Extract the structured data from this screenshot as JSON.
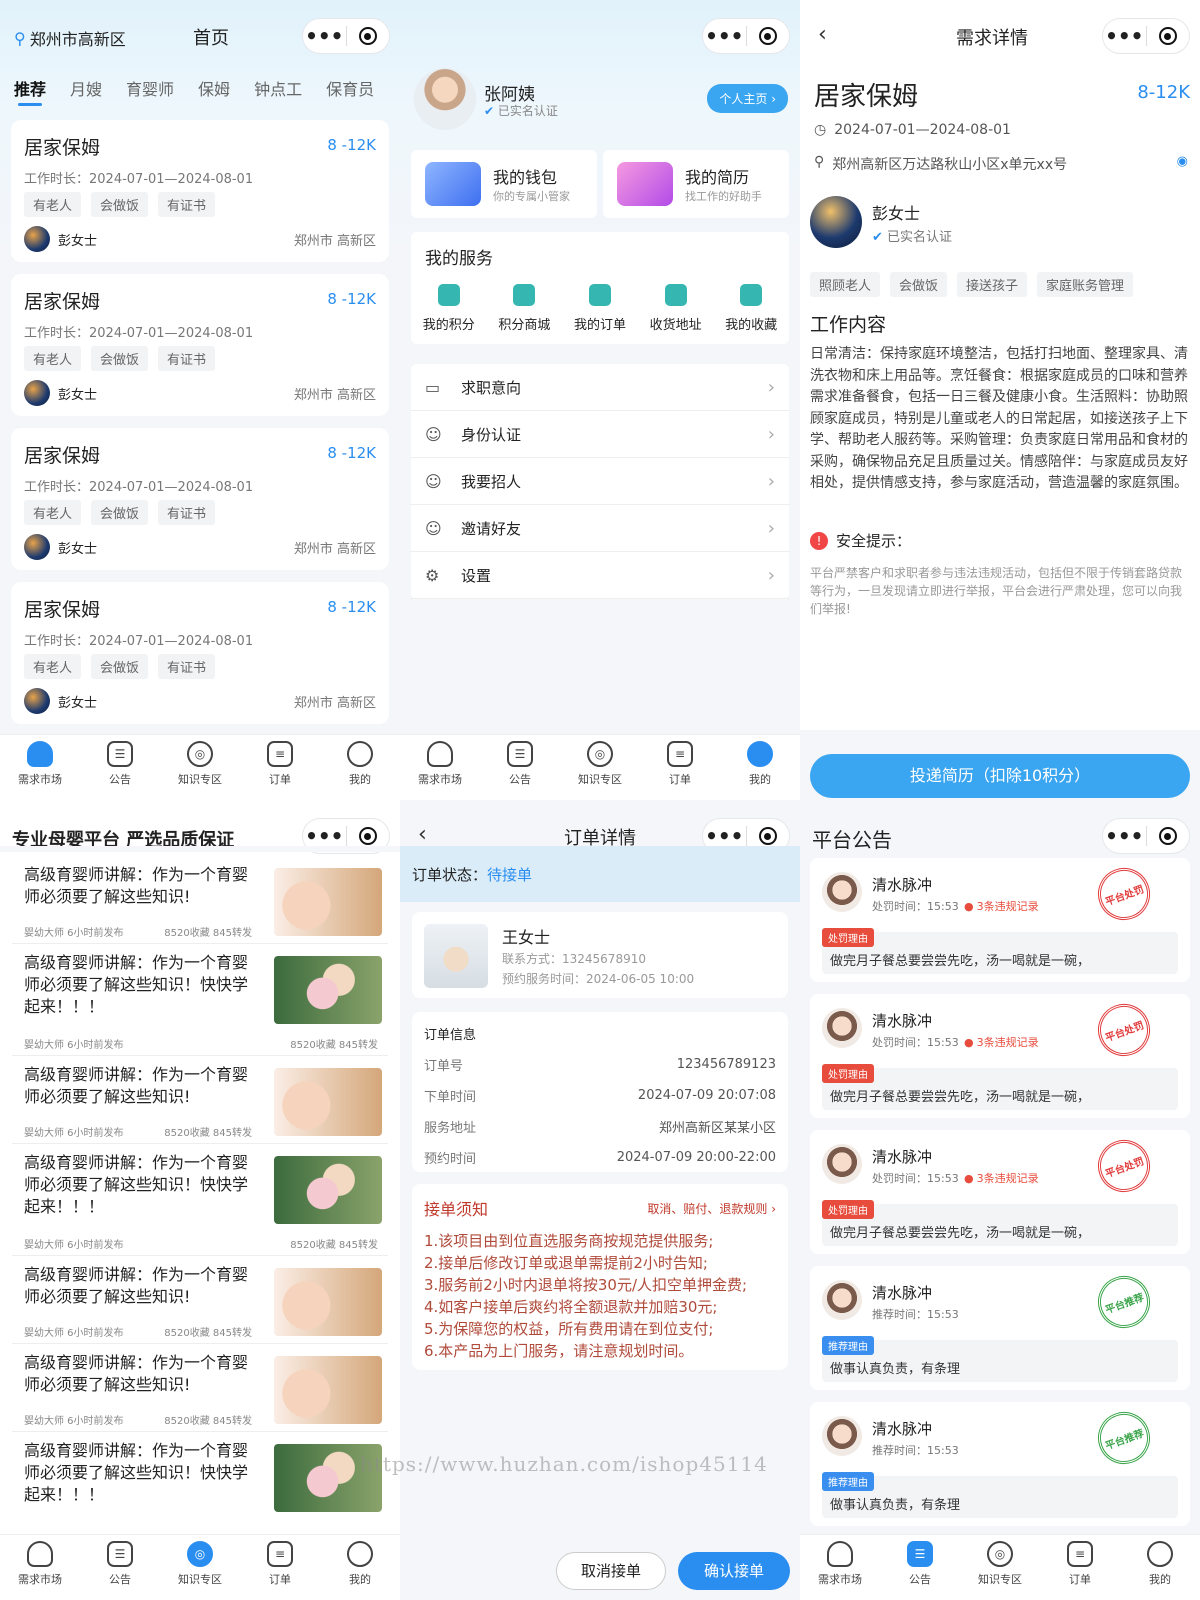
{
  "tabbar": {
    "items": [
      "需求市场",
      "公告",
      "知识专区",
      "订单",
      "我的"
    ]
  },
  "capsule": {
    "dots": "•••"
  },
  "home": {
    "location": "郑州市高新区",
    "title": "首页",
    "tabs": [
      "推荐",
      "月嫂",
      "育婴师",
      "保姆",
      "钟点工",
      "保育员"
    ],
    "jobs": [
      {
        "title": "居家保姆",
        "salary": "8 -12K",
        "duration": "工作时长：2024-07-01—2024-08-01",
        "tags": [
          "有老人",
          "会做饭",
          "有证书"
        ],
        "user": "彭女士",
        "city": "郑州市 高新区"
      },
      {
        "title": "居家保姆",
        "salary": "8 -12K",
        "duration": "工作时长：2024-07-01—2024-08-01",
        "tags": [
          "有老人",
          "会做饭",
          "有证书"
        ],
        "user": "彭女士",
        "city": "郑州市 高新区"
      },
      {
        "title": "居家保姆",
        "salary": "8 -12K",
        "duration": "工作时长：2024-07-01—2024-08-01",
        "tags": [
          "有老人",
          "会做饭",
          "有证书"
        ],
        "user": "彭女士",
        "city": "郑州市 高新区"
      },
      {
        "title": "居家保姆",
        "salary": "8 -12K",
        "duration": "工作时长：2024-07-01—2024-08-01",
        "tags": [
          "有老人",
          "会做饭",
          "有证书"
        ],
        "user": "彭女士",
        "city": "郑州市 高新区"
      }
    ]
  },
  "mine": {
    "name": "张阿姨",
    "verified": "已实名认证",
    "home_btn": "个人主页 ›",
    "wallet": {
      "title": "我的钱包",
      "sub": "你的专属小管家"
    },
    "resume": {
      "title": "我的简历",
      "sub": "找工作的好助手"
    },
    "services_title": "我的服务",
    "services": [
      "我的积分",
      "积分商城",
      "我的订单",
      "收货地址",
      "我的收藏"
    ],
    "menu": [
      "求职意向",
      "身份认证",
      "我要招人",
      "邀请好友",
      "设置"
    ]
  },
  "detail": {
    "nav_title": "需求详情",
    "title": "居家保姆",
    "salary": "8-12K",
    "date": "2024-07-01—2024-08-01",
    "address": "郑州高新区万达路秋山小区x单元xx号",
    "user": "彭女士",
    "verified": "已实名认证",
    "tags": [
      "照顾老人",
      "会做饭",
      "接送孩子",
      "家庭账务管理"
    ],
    "content_title": "工作内容",
    "content": "日常清洁：保持家庭环境整洁，包括打扫地面、整理家具、清洗衣物和床上用品等。烹饪餐食：根据家庭成员的口味和营养需求准备餐食，包括一日三餐及健康小食。生活照料：协助照顾家庭成员，特别是儿童或老人的日常起居，如接送孩子上下学、帮助老人服药等。采购管理：负责家庭日常用品和食材的采购，确保物品充足且质量过关。情感陪伴：与家庭成员友好相处，提供情感支持，参与家庭活动，营造温馨的家庭氛围。",
    "safety_title": "安全提示：",
    "safety": "平台严禁客户和求职者参与违法违规活动，包括但不限于传销套路贷款等行为，一旦发现请立即进行举报，平台会进行严肃处理，您可以向我们举报!",
    "submit": "投递简历（扣除10积分）"
  },
  "knowledge": {
    "title": "专业母婴平台  严选品质保证",
    "articles": [
      {
        "title": "高级育婴师讲解：作为一个育婴师必须要了解这些知识!",
        "author": "婴幼大师 6小时前发布",
        "stats": "8520收藏  845转发",
        "img": "a"
      },
      {
        "title": "高级育婴师讲解：作为一个育婴师必须要了解这些知识！快快学起来！！！",
        "author": "婴幼大师 6小时前发布",
        "stats": "8520收藏  845转发",
        "img": "b"
      },
      {
        "title": "高级育婴师讲解：作为一个育婴师必须要了解这些知识!",
        "author": "婴幼大师 6小时前发布",
        "stats": "8520收藏  845转发",
        "img": "a"
      },
      {
        "title": "高级育婴师讲解：作为一个育婴师必须要了解这些知识！快快学起来！！！",
        "author": "婴幼大师 6小时前发布",
        "stats": "8520收藏  845转发",
        "img": "b"
      },
      {
        "title": "高级育婴师讲解：作为一个育婴师必须要了解这些知识!",
        "author": "婴幼大师 6小时前发布",
        "stats": "8520收藏  845转发",
        "img": "a"
      },
      {
        "title": "高级育婴师讲解：作为一个育婴师必须要了解这些知识!",
        "author": "婴幼大师 6小时前发布",
        "stats": "8520收藏  845转发",
        "img": "a"
      },
      {
        "title": "高级育婴师讲解：作为一个育婴师必须要了解这些知识！快快学起来！！！",
        "author": "",
        "stats": "",
        "img": "b"
      }
    ]
  },
  "order": {
    "nav_title": "订单详情",
    "status_label": "订单状态：",
    "status": "待接单",
    "customer": "王女士",
    "phone": "联系方式：13245678910",
    "appoint": "预约服务时间：2024-06-05 10:00",
    "info_title": "订单信息",
    "rows": [
      {
        "k": "订单号",
        "v": "123456789123"
      },
      {
        "k": "下单时间",
        "v": "2024-07-09 20:07:08"
      },
      {
        "k": "服务地址",
        "v": "郑州高新区某某小区"
      },
      {
        "k": "预约时间",
        "v": "2024-07-09 20:00-22:00"
      }
    ],
    "notice_title": "接单须知",
    "notice_link": "取消、赔付、退款规则  ›",
    "notice": [
      "1.该项目由到位直选服务商按规范提供服务;",
      "2.接单后修改订单或退单需提前2小时告知;",
      "3.服务前2小时内退单将按30元/人扣空单押金费;",
      "4.如客户接单后爽约将全额退款并加赔30元;",
      "5.为保障您的权益，所有费用请在到位支付;",
      "6.本产品为上门服务，请注意规划时间。"
    ],
    "cancel": "取消接单",
    "confirm": "确认接单"
  },
  "watermark": "https://www.huzhan.com/ishop45114",
  "announce": {
    "title": "平台公告",
    "items": [
      {
        "name": "清水脉冲",
        "time": "处罚时间：15:53",
        "record": "3条违规记录",
        "label": "处罚理由",
        "text": "做完月子餐总要尝尝先吃，汤一喝就是一碗，",
        "type": "red",
        "stamp": "平台处罚"
      },
      {
        "name": "清水脉冲",
        "time": "处罚时间：15:53",
        "record": "3条违规记录",
        "label": "处罚理由",
        "text": "做完月子餐总要尝尝先吃，汤一喝就是一碗，",
        "type": "red",
        "stamp": "平台处罚"
      },
      {
        "name": "清水脉冲",
        "time": "处罚时间：15:53",
        "record": "3条违规记录",
        "label": "处罚理由",
        "text": "做完月子餐总要尝尝先吃，汤一喝就是一碗，",
        "type": "red",
        "stamp": "平台处罚"
      },
      {
        "name": "清水脉冲",
        "time": "推荐时间：15:53",
        "record": "",
        "label": "推荐理由",
        "text": "做事认真负责，有条理",
        "type": "blue",
        "stamp": "平台推荐"
      },
      {
        "name": "清水脉冲",
        "time": "推荐时间：15:53",
        "record": "",
        "label": "推荐理由",
        "text": "做事认真负责，有条理",
        "type": "blue",
        "stamp": "平台推荐"
      }
    ]
  }
}
